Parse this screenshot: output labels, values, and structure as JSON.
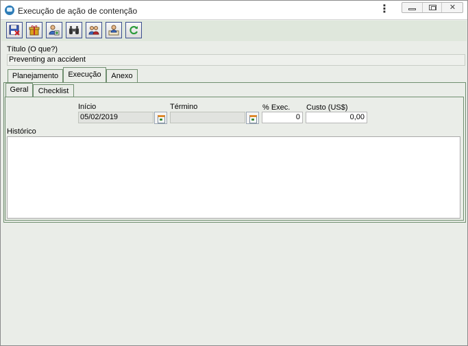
{
  "window": {
    "title": "Execução de ação de contenção",
    "more_icon": "kebab-menu-icon",
    "minimize_icon": "minimize-icon",
    "maximize_icon": "maximize-icon",
    "close_icon": "close-icon",
    "close_glyph": "✕"
  },
  "toolbar": {
    "buttons": [
      {
        "icon": "save-exit-icon"
      },
      {
        "icon": "gift-icon"
      },
      {
        "icon": "user-add-icon"
      },
      {
        "icon": "binoculars-icon"
      },
      {
        "icon": "users-icon"
      },
      {
        "icon": "person-document-icon"
      },
      {
        "icon": "refresh-icon"
      }
    ]
  },
  "title_field": {
    "label": "Título (O que?)",
    "value": "Preventing an accident"
  },
  "tabs": [
    "Planejamento",
    "Execução",
    "Anexo"
  ],
  "active_tab": "Execução",
  "subtabs": [
    "Geral",
    "Checklist"
  ],
  "active_subtab": "Geral",
  "form": {
    "inicio": {
      "label": "Início",
      "value": "05/02/2019",
      "icon": "calendar-icon"
    },
    "termino": {
      "label": "Término",
      "value": "",
      "icon": "calendar-icon"
    },
    "exec": {
      "label": "% Exec.",
      "value": "0"
    },
    "custo": {
      "label": "Custo (US$)",
      "value": "0,00"
    },
    "historico": {
      "label": "Histórico",
      "value": ""
    }
  },
  "colors": {
    "window_bg": "#eaede8",
    "toolbar_bg": "#dfe7dc",
    "tab_border": "#6f8e6f",
    "button_border": "#3a4d8f"
  }
}
